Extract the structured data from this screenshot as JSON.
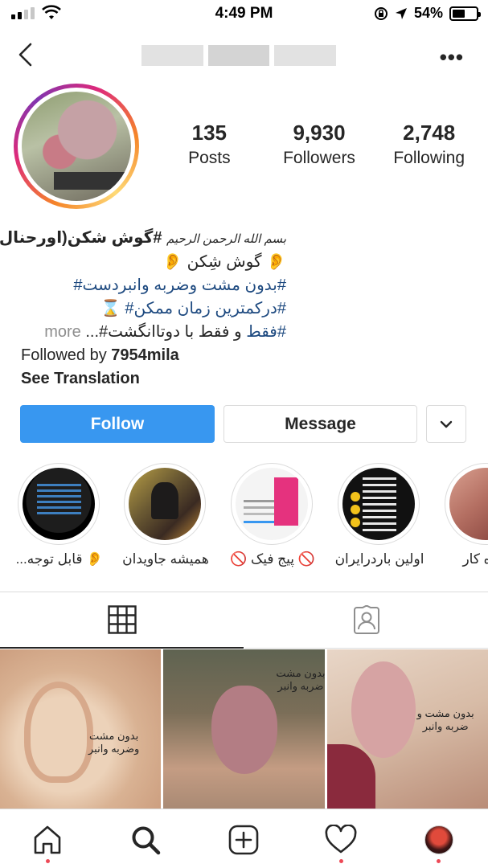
{
  "status": {
    "time": "4:49 PM",
    "battery": "54%",
    "battery_level": 0.54
  },
  "header": {
    "back_icon": "chevron-left-icon",
    "more_icon": "more-dots-icon",
    "more_label": "•••"
  },
  "profile": {
    "stats": [
      {
        "num": "135",
        "label": "Posts"
      },
      {
        "num": "9,930",
        "label": "Followers"
      },
      {
        "num": "2,748",
        "label": "Following"
      }
    ],
    "bio": {
      "line1_prefix": "بسم الله الرحمن الرحیم",
      "line1_hash": "#گوش شکن(اورحنال)#",
      "line2": "👂 گوش شِکن 👂",
      "line3_hash": "#بدون مشت وضربه وانبردست#",
      "line4_hash": "#درکمترین زمان ممکن#",
      "line4_emoji": "⌛",
      "line5_hash": "#فقط",
      "line5_text": " و فقط با دوتاانگشت#...",
      "line5_more": "more",
      "followed_by_prefix": "Followed by ",
      "followed_by_user": "7954mila",
      "see_translation": "See Translation"
    }
  },
  "actions": {
    "follow": "Follow",
    "message": "Message",
    "dropdown_icon": "chevron-down-icon"
  },
  "highlights": [
    {
      "label": "👂 قابل توجه..."
    },
    {
      "label": "همیشه جاویدان"
    },
    {
      "label": "🚫 پیج فیک 🚫"
    },
    {
      "label": "اولین باردرایران"
    },
    {
      "label": "ه کار"
    }
  ],
  "tabs": {
    "grid_icon": "grid-icon",
    "tagged_icon": "tagged-icon"
  },
  "posts": [
    {
      "caption_l1": "بدون مشت",
      "caption_l2": "وضربه وانبر"
    },
    {
      "caption_l1": "بدون مشت",
      "caption_l2": "ضربه وانبر"
    },
    {
      "caption_l1": "بدون مشت و",
      "caption_l2": "ضربه وانبر"
    }
  ],
  "bottom_nav": [
    "home-icon",
    "search-icon",
    "new-post-icon",
    "activity-icon",
    "profile-icon"
  ]
}
